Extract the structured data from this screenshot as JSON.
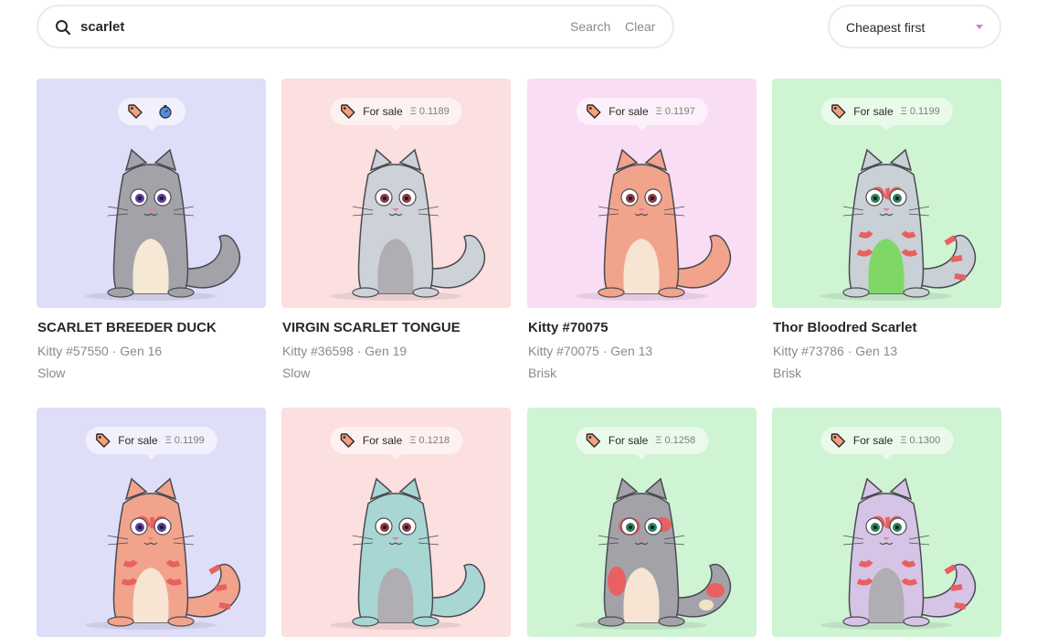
{
  "search": {
    "value": "scarlet",
    "placeholder": "",
    "search_label": "Search",
    "clear_label": "Clear"
  },
  "sort": {
    "selected": "Cheapest first",
    "caret_color": "#d07cd6"
  },
  "icons": {
    "search": "search-icon",
    "tag": "price-tag-icon",
    "cooldown": "stopwatch-icon"
  },
  "cards": [
    {
      "name": "SCARLET BREEDER DUCK",
      "meta": "Kitty #57550 · Gen 16",
      "speed": "Slow",
      "sale": "",
      "price": "",
      "bg": "#dfdef8",
      "body": "#a3a2a9",
      "belly": "#f5e8d4",
      "eye": "#5b3a99",
      "pattern": "none",
      "cooldown": true
    },
    {
      "name": "VIRGIN SCARLET TONGUE",
      "meta": "Kitty #36598 · Gen 19",
      "speed": "Slow",
      "sale": "For sale",
      "price": "Ξ 0.1189",
      "bg": "#fcdfdf",
      "body": "#ccd2d7",
      "belly": "#b0adb3",
      "eye": "#8c3a44",
      "pattern": "none",
      "cooldown": false
    },
    {
      "name": "Kitty #70075",
      "meta": "Kitty #70075 · Gen 13",
      "speed": "Brisk",
      "sale": "For sale",
      "price": "Ξ 0.1197",
      "bg": "#f8ddf4",
      "body": "#f2a38b",
      "belly": "#f7e4d2",
      "eye": "#8c3a44",
      "pattern": "none",
      "cooldown": false
    },
    {
      "name": "Thor Bloodred Scarlet",
      "meta": "Kitty #73786 · Gen 13",
      "speed": "Brisk",
      "sale": "For sale",
      "price": "Ξ 0.1199",
      "bg": "#cff4d3",
      "body": "#c9d0d6",
      "belly": "#7fd866",
      "eye": "#2d7f5a",
      "pattern": "stripes",
      "cooldown": false
    },
    {
      "name": "",
      "meta": "",
      "speed": "",
      "sale": "For sale",
      "price": "Ξ 0.1199",
      "bg": "#dfdef8",
      "body": "#f2a38b",
      "belly": "#f7e4d2",
      "eye": "#5b3a99",
      "pattern": "stripes",
      "cooldown": false
    },
    {
      "name": "",
      "meta": "",
      "speed": "",
      "sale": "For sale",
      "price": "Ξ 0.1218",
      "bg": "#fcdfdf",
      "body": "#a8d6d3",
      "belly": "#b0adb3",
      "eye": "#8c3a44",
      "pattern": "none",
      "cooldown": false
    },
    {
      "name": "",
      "meta": "",
      "speed": "",
      "sale": "For sale",
      "price": "Ξ 0.1258",
      "bg": "#cff4d3",
      "body": "#a3a2a9",
      "belly": "#f7e4d2",
      "eye": "#2d7f5a",
      "pattern": "spots",
      "cooldown": false
    },
    {
      "name": "",
      "meta": "",
      "speed": "",
      "sale": "For sale",
      "price": "Ξ 0.1300",
      "bg": "#cff4d3",
      "body": "#d6c4e6",
      "belly": "#b0adb3",
      "eye": "#2d7f5a",
      "pattern": "stripes",
      "cooldown": false
    }
  ]
}
